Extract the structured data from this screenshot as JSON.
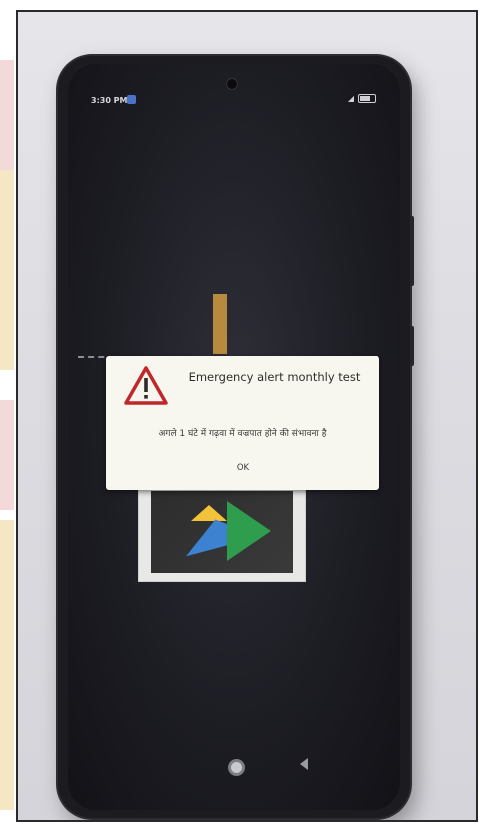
{
  "status_bar": {
    "time": "3:30 PM",
    "signal_icon": "signal-icon",
    "battery_icon": "battery-icon"
  },
  "alert": {
    "icon": "warning-icon",
    "title": "Emergency alert monthly test",
    "message": "अगले 1 घंटे में गढ़वा में वज्रपात होने की संभावना है",
    "ok_label": "OK"
  },
  "navigation": {
    "home_icon": "home-icon",
    "back_icon": "back-icon"
  },
  "colors": {
    "dialog_bg": "#f8f7ef",
    "warning_red": "#c0272d",
    "screen_bg": "#1d1d24"
  }
}
